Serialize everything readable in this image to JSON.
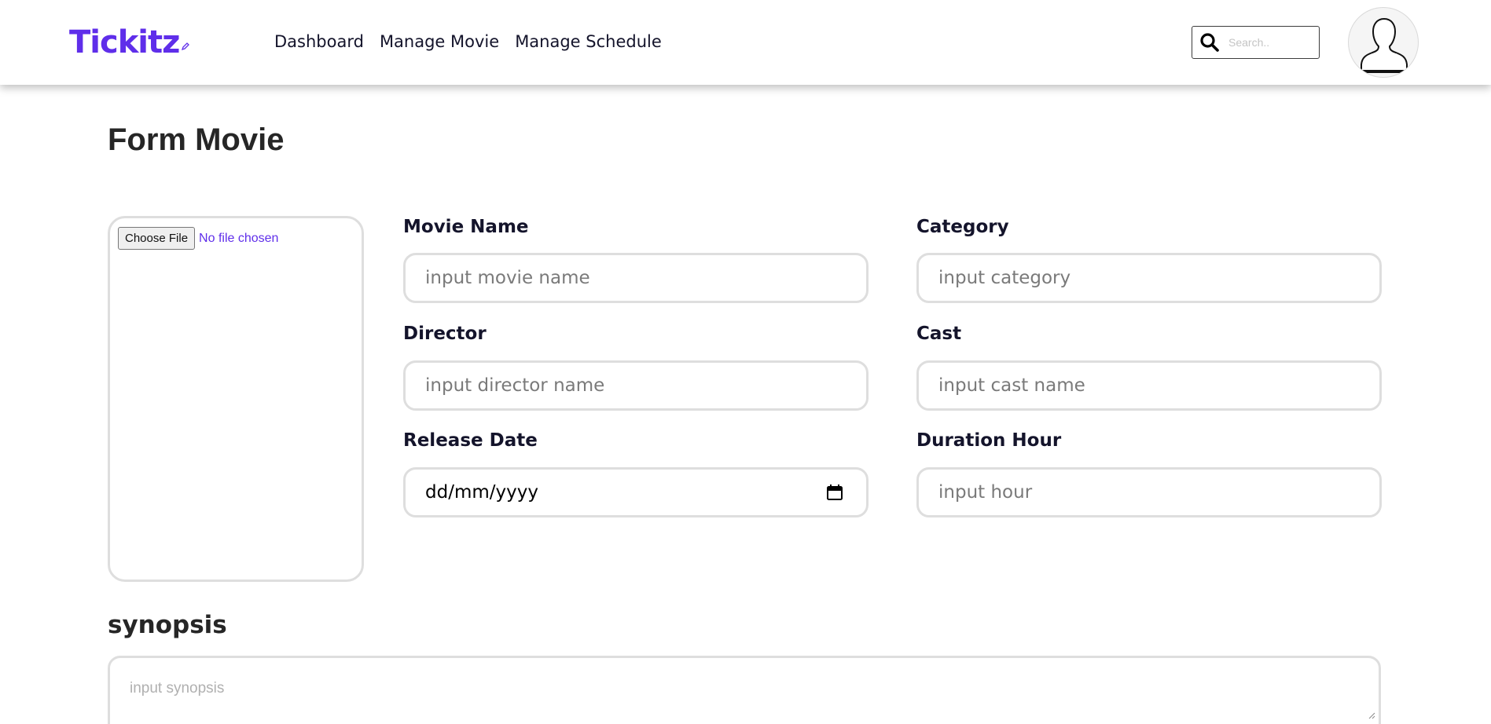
{
  "header": {
    "logo": "Tickitz",
    "nav": [
      "Dashboard",
      "Manage Movie",
      "Manage Schedule"
    ],
    "search_placeholder": "Search..",
    "search_icon": "search-icon",
    "avatar_icon": "user-avatar-icon"
  },
  "page": {
    "title": "Form Movie"
  },
  "poster": {
    "button_label": "Choose File",
    "status": "No file chosen"
  },
  "form": {
    "movie_name": {
      "label": "Movie Name",
      "placeholder": "input movie name"
    },
    "category": {
      "label": "Category",
      "placeholder": "input category"
    },
    "director": {
      "label": "Director",
      "placeholder": "input director name"
    },
    "cast": {
      "label": "Cast",
      "placeholder": "input cast name"
    },
    "release_date": {
      "label": "Release Date",
      "value": "dd/mm/yyyy"
    },
    "duration": {
      "label": "Duration Hour",
      "placeholder": "input hour"
    }
  },
  "synopsis": {
    "label": "synopsis",
    "placeholder": "input synopsis"
  },
  "colors": {
    "brand": "#5f2eea",
    "border": "#dedede",
    "text": "#14142b"
  }
}
